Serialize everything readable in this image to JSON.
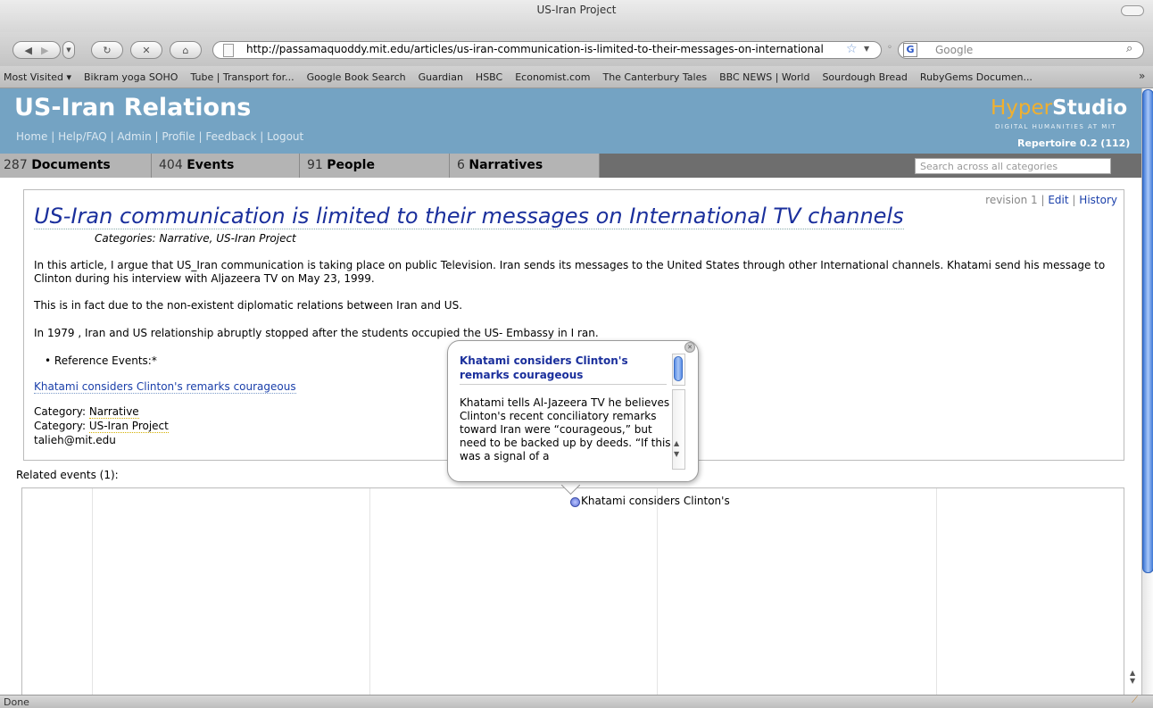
{
  "browser": {
    "window_title": "US-Iran Project",
    "url": "http://passamaquoddy.mit.edu/articles/us-iran-communication-is-limited-to-their-messages-on-international",
    "search_engine": "Google",
    "status": "Done",
    "bookmarks": [
      "Most Visited ▾",
      "Bikram yoga SOHO",
      "Tube | Transport for...",
      "Google Book Search",
      "Guardian",
      "HSBC",
      "Economist.com",
      "The Canterbury Tales",
      "BBC NEWS | World",
      "Sourdough Bread",
      "RubyGems Documen..."
    ],
    "overflow": "»"
  },
  "site": {
    "title": "US-Iran Relations",
    "nav": "Home | Help/FAQ | Admin | Profile | Feedback | Logout",
    "brand_a": "Hyper",
    "brand_b": "Studio",
    "brand_sub": "DIGITAL HUMANITIES AT MIT",
    "version": "Repertoire 0.2 (112)",
    "accent": "#74a3c3"
  },
  "tabs": [
    {
      "count": "287",
      "label": "Documents"
    },
    {
      "count": "404",
      "label": "Events"
    },
    {
      "count": "91",
      "label": "People"
    },
    {
      "count": "6",
      "label": "Narratives"
    }
  ],
  "search_placeholder": "Search across all categories",
  "article": {
    "revision": "revision 1",
    "sep": "|",
    "edit": "Edit",
    "history": "History",
    "title": "US-Iran communication is limited to their messages on International TV channels",
    "categories": "Categories: Narrative, US-Iran Project",
    "p1": "In this article, I argue that US_Iran communication is taking place on public Television. Iran sends its messages to the United States through other International channels. Khatami send his message to Clinton during his interview with Aljazeera TV on May 23, 1999.",
    "p2": "This is in fact due to the non-existent diplomatic relations between Iran and US.",
    "p3": "In 1979 , Iran and US relationship abruptly stopped after the students occupied the US- Embassy in I ran.",
    "bullet": "Reference Events:*",
    "event_link": "Khatami considers Clinton's remarks courageous",
    "cat1_label": "Category: ",
    "cat1_value": "Narrative",
    "cat2_label": "Category: ",
    "cat2_value": "US-Iran Project",
    "author": "talieh@mit.edu"
  },
  "related_label": "Related events (1):",
  "popup": {
    "title": "Khatami considers Clinton's remarks courageous",
    "body": "Khatami tells Al-Jazeera TV he believes Clinton's recent conciliatory remarks toward Iran were “courageous,” but need to be backed up by deeds. “If this was a signal of a"
  },
  "timeline": {
    "event_label": "Khatami considers Clinton's"
  }
}
